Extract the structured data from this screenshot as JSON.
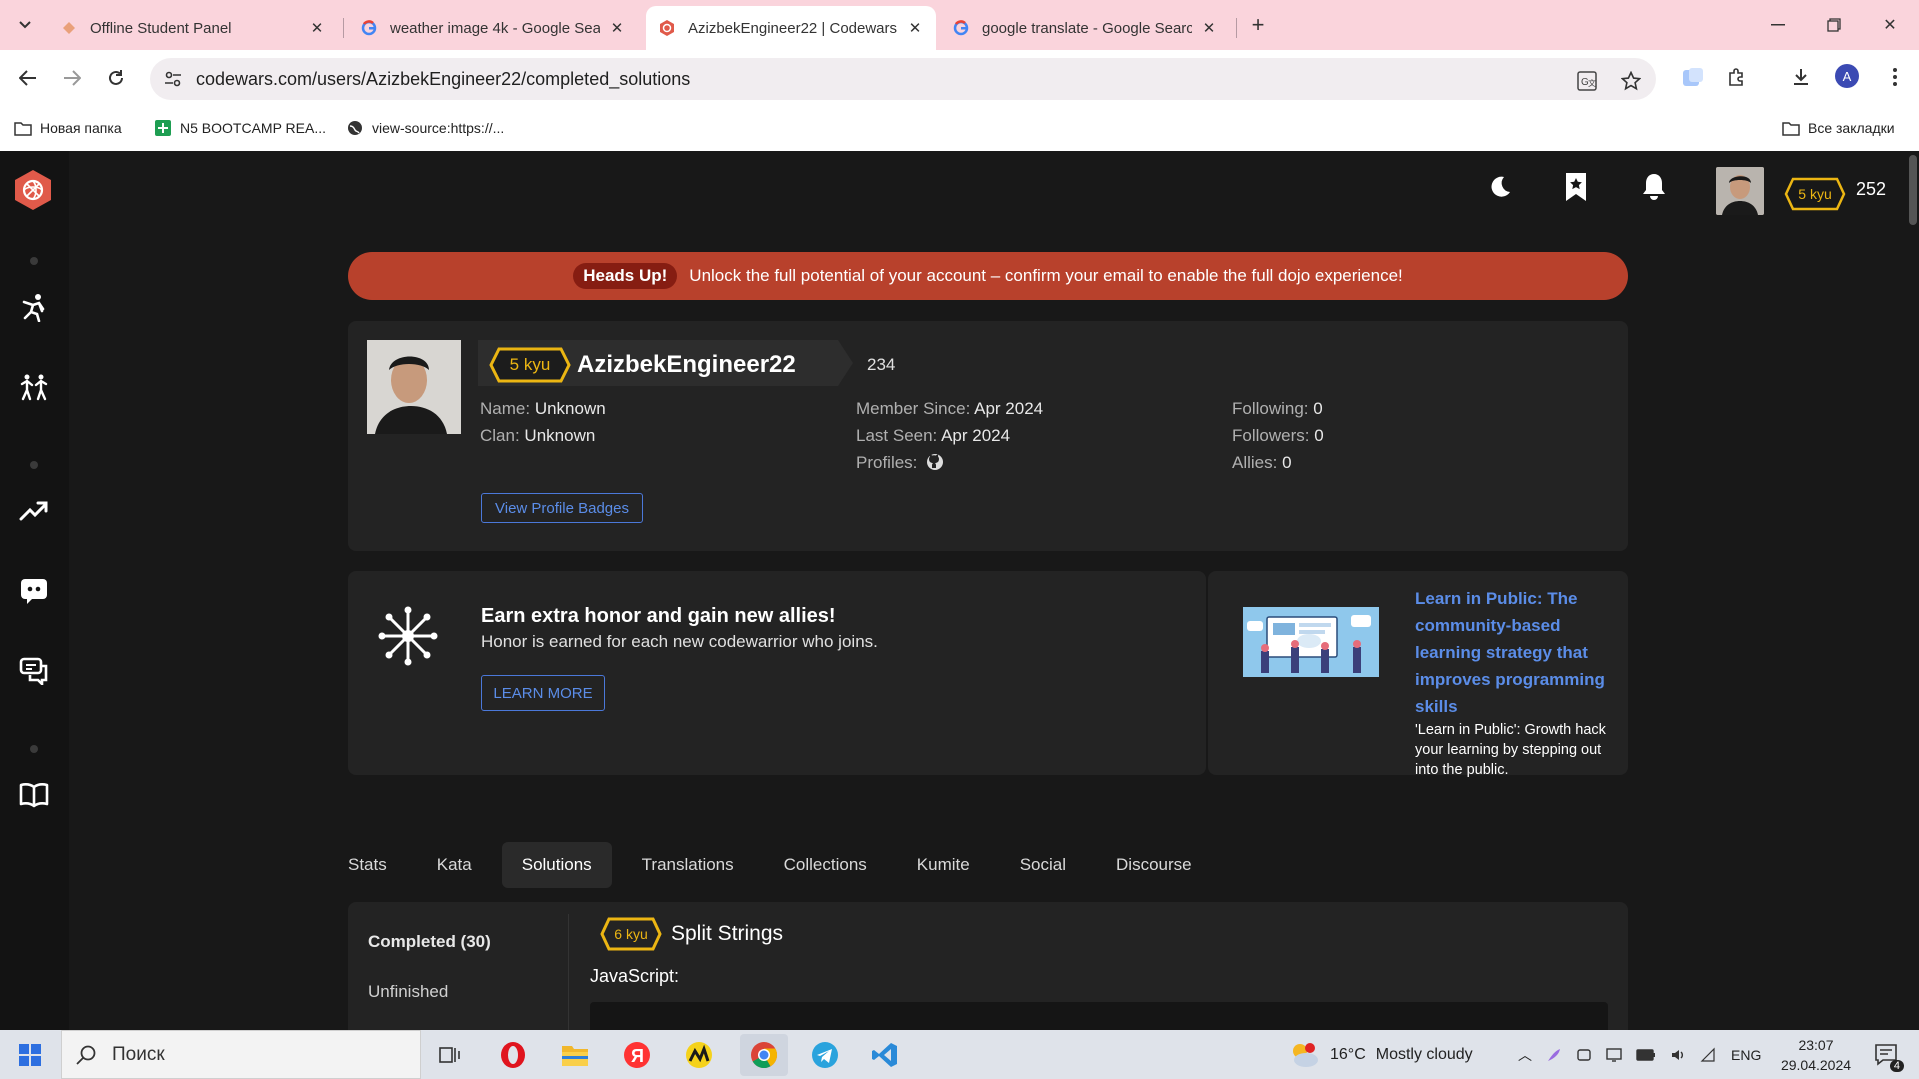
{
  "browser": {
    "tabs": [
      {
        "title": "Offline Student Panel",
        "favicon": "orange-diamond-icon"
      },
      {
        "title": "weather image 4k - Google Sea",
        "favicon": "google-icon"
      },
      {
        "title": "AzizbekEngineer22 | Codewars",
        "favicon": "codewars-icon"
      },
      {
        "title": "google translate - Google Searc",
        "favicon": "google-icon"
      }
    ],
    "url": "codewars.com/users/AzizbekEngineer22/completed_solutions",
    "profile_initial": "A",
    "bookmarks": [
      {
        "label": "Новая папка",
        "icon": "folder-icon"
      },
      {
        "label": "N5 BOOTCAMP REA...",
        "icon": "sheets-icon"
      },
      {
        "label": "view-source:https://...",
        "icon": "globe-icon"
      }
    ],
    "all_bookmarks": "Все закладки"
  },
  "header": {
    "rank": "5 kyu",
    "honor": "252"
  },
  "banner": {
    "label": "Heads Up!",
    "text": "Unlock the full potential of your account – confirm your email to enable the full dojo experience!"
  },
  "profile": {
    "rank": "5 kyu",
    "username": "AzizbekEngineer22",
    "honor": "234",
    "name_label": "Name:",
    "name": "Unknown",
    "clan_label": "Clan:",
    "clan": "Unknown",
    "member_since_label": "Member Since:",
    "member_since": "Apr 2024",
    "last_seen_label": "Last Seen:",
    "last_seen": "Apr 2024",
    "profiles_label": "Profiles:",
    "following_label": "Following:",
    "following": "0",
    "followers_label": "Followers:",
    "followers": "0",
    "allies_label": "Allies:",
    "allies": "0",
    "badges_button": "View Profile Badges"
  },
  "promo": {
    "title": "Earn extra honor and gain new allies!",
    "subtitle": "Honor is earned for each new codewarrior who joins.",
    "button": "LEARN MORE"
  },
  "blog": {
    "title": "Learn in Public: The community-based learning strategy that improves programming skills",
    "excerpt": "'Learn in Public': Growth hack your learning by stepping out into the public."
  },
  "profile_tabs": [
    "Stats",
    "Kata",
    "Solutions",
    "Translations",
    "Collections",
    "Kumite",
    "Social",
    "Discourse"
  ],
  "solutions": {
    "filters": [
      "Completed (30)",
      "Unfinished"
    ],
    "kata_rank": "6 kyu",
    "kata_title": "Split Strings",
    "language": "JavaScript:"
  },
  "taskbar": {
    "search": "Поиск",
    "weather_temp": "16°C",
    "weather_text": "Mostly cloudy",
    "lang": "ENG",
    "time": "23:07",
    "date": "29.04.2024",
    "notifications": "4"
  },
  "colors": {
    "accent_red": "#b8412c",
    "kyu_yellow": "#ecb613",
    "link_blue": "#5b8de8"
  }
}
